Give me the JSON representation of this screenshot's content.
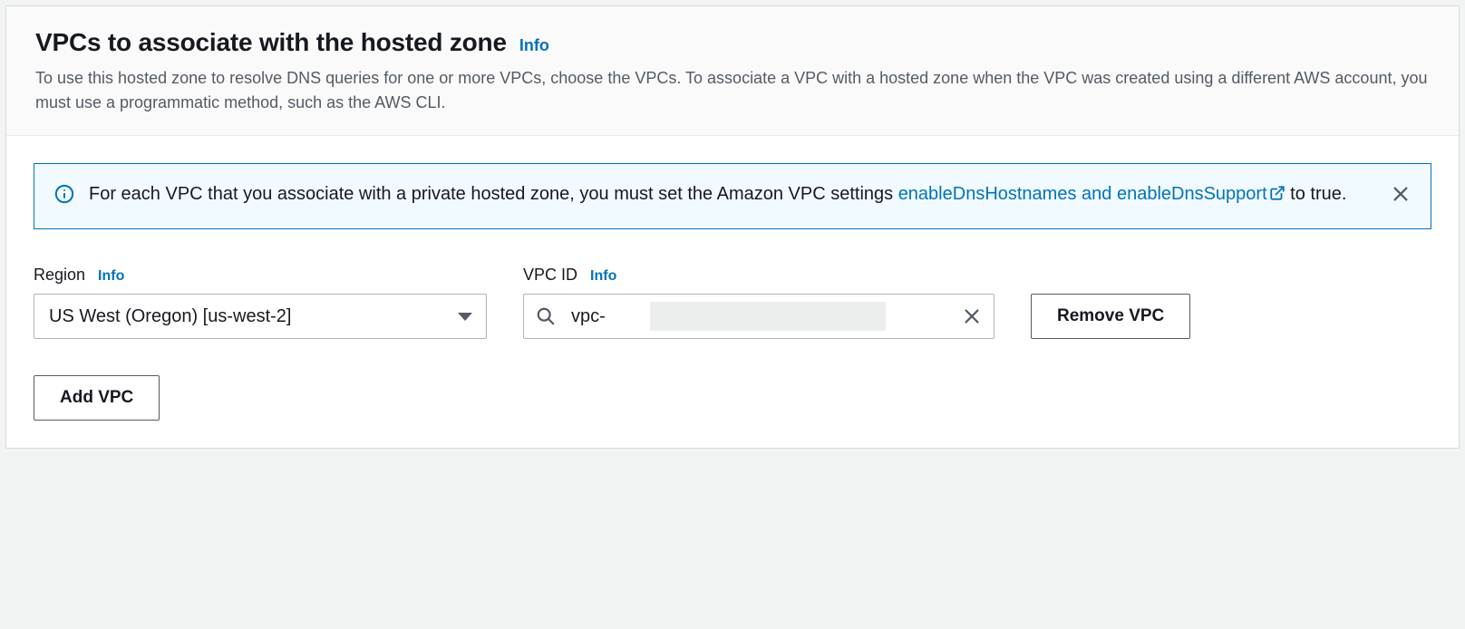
{
  "header": {
    "title": "VPCs to associate with the hosted zone",
    "info_label": "Info",
    "description": "To use this hosted zone to resolve DNS queries for one or more VPCs, choose the VPCs. To associate a VPC with a hosted zone when the VPC was created using a different AWS account, you must use a programmatic method, such as the AWS CLI."
  },
  "alert": {
    "text_before_link": "For each VPC that you associate with a private hosted zone, you must set the Amazon VPC settings ",
    "link_text": "enableDnsHostnames and enableDnsSupport",
    "text_after_link": " to true."
  },
  "region_field": {
    "label": "Region",
    "info_label": "Info",
    "selected": "US West (Oregon) [us-west-2]"
  },
  "vpc_field": {
    "label": "VPC ID",
    "info_label": "Info",
    "value": "vpc-"
  },
  "buttons": {
    "remove": "Remove VPC",
    "add": "Add VPC"
  }
}
